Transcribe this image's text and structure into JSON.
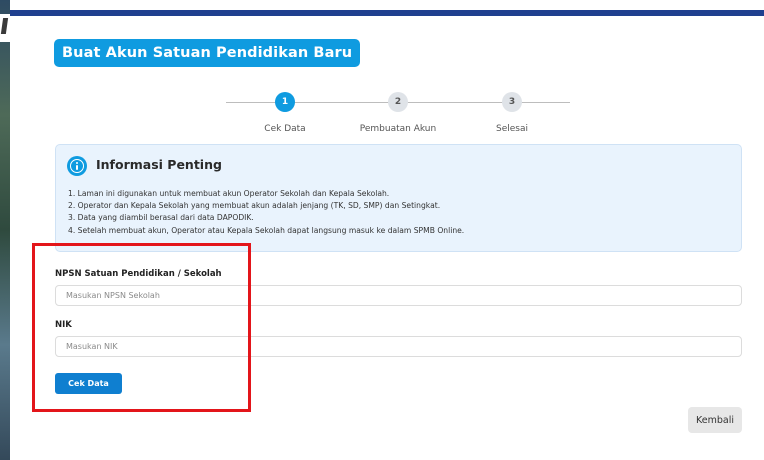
{
  "page": {
    "title": "Buat Akun Satuan Pendidikan Baru"
  },
  "stepper": {
    "steps": [
      {
        "number": "1",
        "label": "Cek Data",
        "state": "active"
      },
      {
        "number": "2",
        "label": "Pembuatan Akun",
        "state": "inactive"
      },
      {
        "number": "3",
        "label": "Selesai",
        "state": "inactive"
      }
    ]
  },
  "info": {
    "icon": "info-icon",
    "title": "Informasi Penting",
    "items": [
      "1. Laman ini digunakan untuk membuat akun Operator Sekolah dan Kepala Sekolah.",
      "2. Operator dan Kepala Sekolah yang membuat akun adalah jenjang (TK, SD, SMP) dan Setingkat.",
      "3. Data yang diambil berasal dari data DAPODIK.",
      "4. Setelah membuat akun, Operator atau Kepala Sekolah dapat langsung masuk ke dalam SPMB Online."
    ]
  },
  "form": {
    "npsn": {
      "label": "NPSN Satuan Pendidikan / Sekolah",
      "placeholder": "Masukan NPSN Sekolah",
      "value": ""
    },
    "nik": {
      "label": "NIK",
      "placeholder": "Masukan NIK",
      "value": ""
    },
    "submit_label": "Cek Data"
  },
  "footer": {
    "back_label": "Kembali"
  },
  "colors": {
    "primary": "#0f9be0",
    "button": "#0f7fd0",
    "topbar": "#1f3f8f",
    "highlight": "#e3151a",
    "info_bg": "#e9f3fd"
  }
}
